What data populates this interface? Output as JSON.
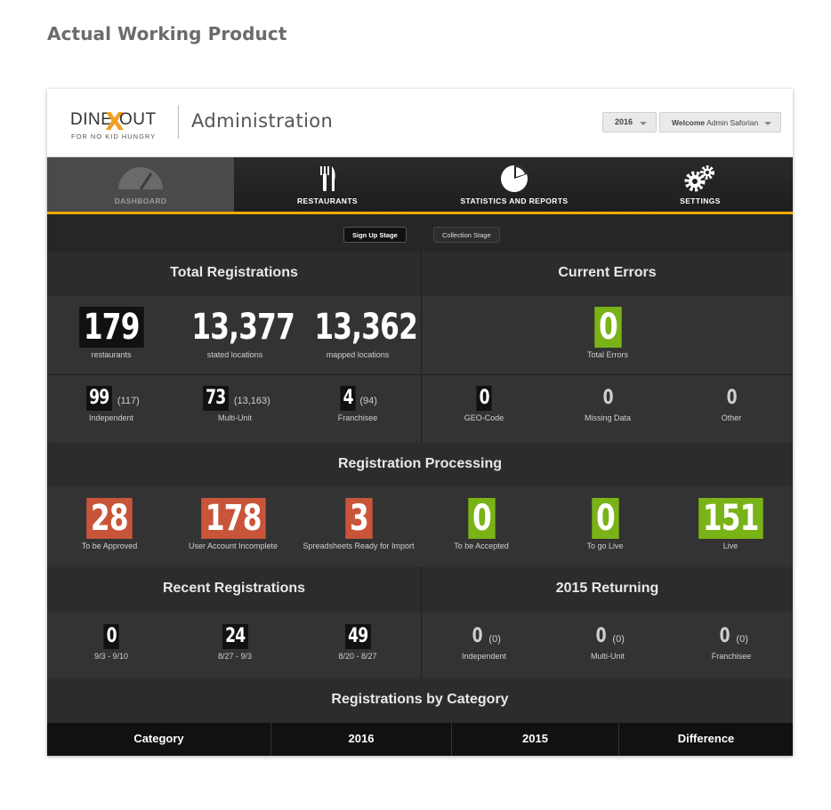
{
  "caption": "Actual Working Product",
  "header": {
    "logo": {
      "dine": "DINE",
      "x": "X",
      "out": "OUT",
      "tagline": "FOR NO KID HUNGRY"
    },
    "title": "Administration",
    "year": "2016",
    "welcome_prefix": "Welcome",
    "welcome_user": "Admin Saforian"
  },
  "nav": [
    {
      "label": "DASHBOARD",
      "icon": "gauge-icon"
    },
    {
      "label": "RESTAURANTS",
      "icon": "fork-knife-icon"
    },
    {
      "label": "STATISTICS AND REPORTS",
      "icon": "pie-chart-icon"
    },
    {
      "label": "SETTINGS",
      "icon": "gears-icon"
    }
  ],
  "stages": {
    "active": "Sign Up Stage",
    "inactive": "Collection Stage"
  },
  "total_registrations": {
    "title": "Total Registrations",
    "restaurants": {
      "value": "179",
      "label": "restaurants"
    },
    "stated": {
      "value": "13,377",
      "label": "stated locations"
    },
    "mapped": {
      "value": "13,362",
      "label": "mapped locations"
    },
    "independent": {
      "value": "99",
      "sub": "(117)",
      "label": "Independent"
    },
    "multi_unit": {
      "value": "73",
      "sub": "(13,163)",
      "label": "Multi-Unit"
    },
    "franchisee": {
      "value": "4",
      "sub": "(94)",
      "label": "Franchisee"
    }
  },
  "current_errors": {
    "title": "Current Errors",
    "total": {
      "value": "0",
      "label": "Total Errors"
    },
    "geo": {
      "value": "0",
      "label": "GEO-Code"
    },
    "missing": {
      "value": "0",
      "label": "Missing Data"
    },
    "other": {
      "value": "0",
      "label": "Other"
    }
  },
  "processing": {
    "title": "Registration Processing",
    "items": [
      {
        "value": "28",
        "label": "To be Approved",
        "color": "#c8553a"
      },
      {
        "value": "178",
        "label": "User Account Incomplete",
        "color": "#c8553a"
      },
      {
        "value": "3",
        "label": "Spreadsheets Ready for Import",
        "color": "#c8553a"
      },
      {
        "value": "0",
        "label": "To be Accepted",
        "color": "#7ab317"
      },
      {
        "value": "0",
        "label": "To go Live",
        "color": "#7ab317"
      },
      {
        "value": "151",
        "label": "Live",
        "color": "#7ab317"
      }
    ]
  },
  "recent": {
    "title": "Recent Registrations",
    "items": [
      {
        "value": "0",
        "label": "9/3 - 9/10"
      },
      {
        "value": "24",
        "label": "8/27 - 9/3"
      },
      {
        "value": "49",
        "label": "8/20 - 8/27"
      }
    ]
  },
  "returning": {
    "title": "2015 Returning",
    "items": [
      {
        "value": "0",
        "sub": "(0)",
        "label": "Independent"
      },
      {
        "value": "0",
        "sub": "(0)",
        "label": "Multi-Unit"
      },
      {
        "value": "0",
        "sub": "(0)",
        "label": "Franchisee"
      }
    ]
  },
  "by_category": {
    "title": "Registrations by Category",
    "columns": [
      "Category",
      "2016",
      "2015",
      "Difference"
    ]
  },
  "colors": {
    "accent": "#f2a900",
    "green": "#7ab317",
    "red": "#c8553a"
  }
}
